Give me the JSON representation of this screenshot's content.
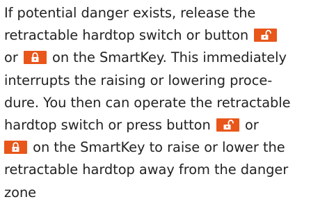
{
  "paragraph": {
    "line1": "If potential danger exists, release the",
    "line2": "retractable hardtop switch or button",
    "line3a": "or",
    "line3b": "on the SmartKey. This immediately",
    "line4": "interrupts the raising or lowering proce-",
    "line5": "dure. You then can operate the retractable",
    "line6a": "hardtop switch or press button",
    "line6b": "or",
    "line7": "on the SmartKey to raise or lower the",
    "line8": "retractable hardtop away from the danger",
    "line9": "zone"
  },
  "icons": {
    "unlock": "unlock-icon",
    "lock": "lock-icon",
    "color": "#e8561a"
  }
}
